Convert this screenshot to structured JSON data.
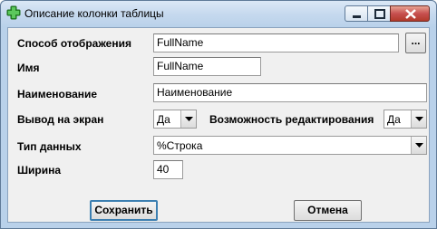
{
  "window": {
    "title": "Описание колонки таблицы",
    "icon": "green-plus-icon",
    "controls": [
      "minimize-icon",
      "maximize-icon",
      "close-icon"
    ]
  },
  "form": {
    "display_mode": {
      "label": "Способ отображения",
      "value": "FullName",
      "browse_label": "..."
    },
    "name": {
      "label": "Имя",
      "value": "FullName"
    },
    "caption": {
      "label": "Наименование",
      "value": "Наименование"
    },
    "show_on_screen": {
      "label": "Вывод на экран",
      "value": "Да"
    },
    "editable": {
      "label": "Возможность редактирования",
      "value": "Да"
    },
    "data_type": {
      "label": "Тип данных",
      "value": "%Строка"
    },
    "width": {
      "label": "Ширина",
      "value": "40"
    }
  },
  "buttons": {
    "save": "Сохранить",
    "cancel": "Отмена"
  },
  "colors": {
    "frame": "#b9d1ea",
    "client": "#f0f0f0",
    "close_button": "#c75050",
    "default_button_border": "#3c7fb1"
  }
}
